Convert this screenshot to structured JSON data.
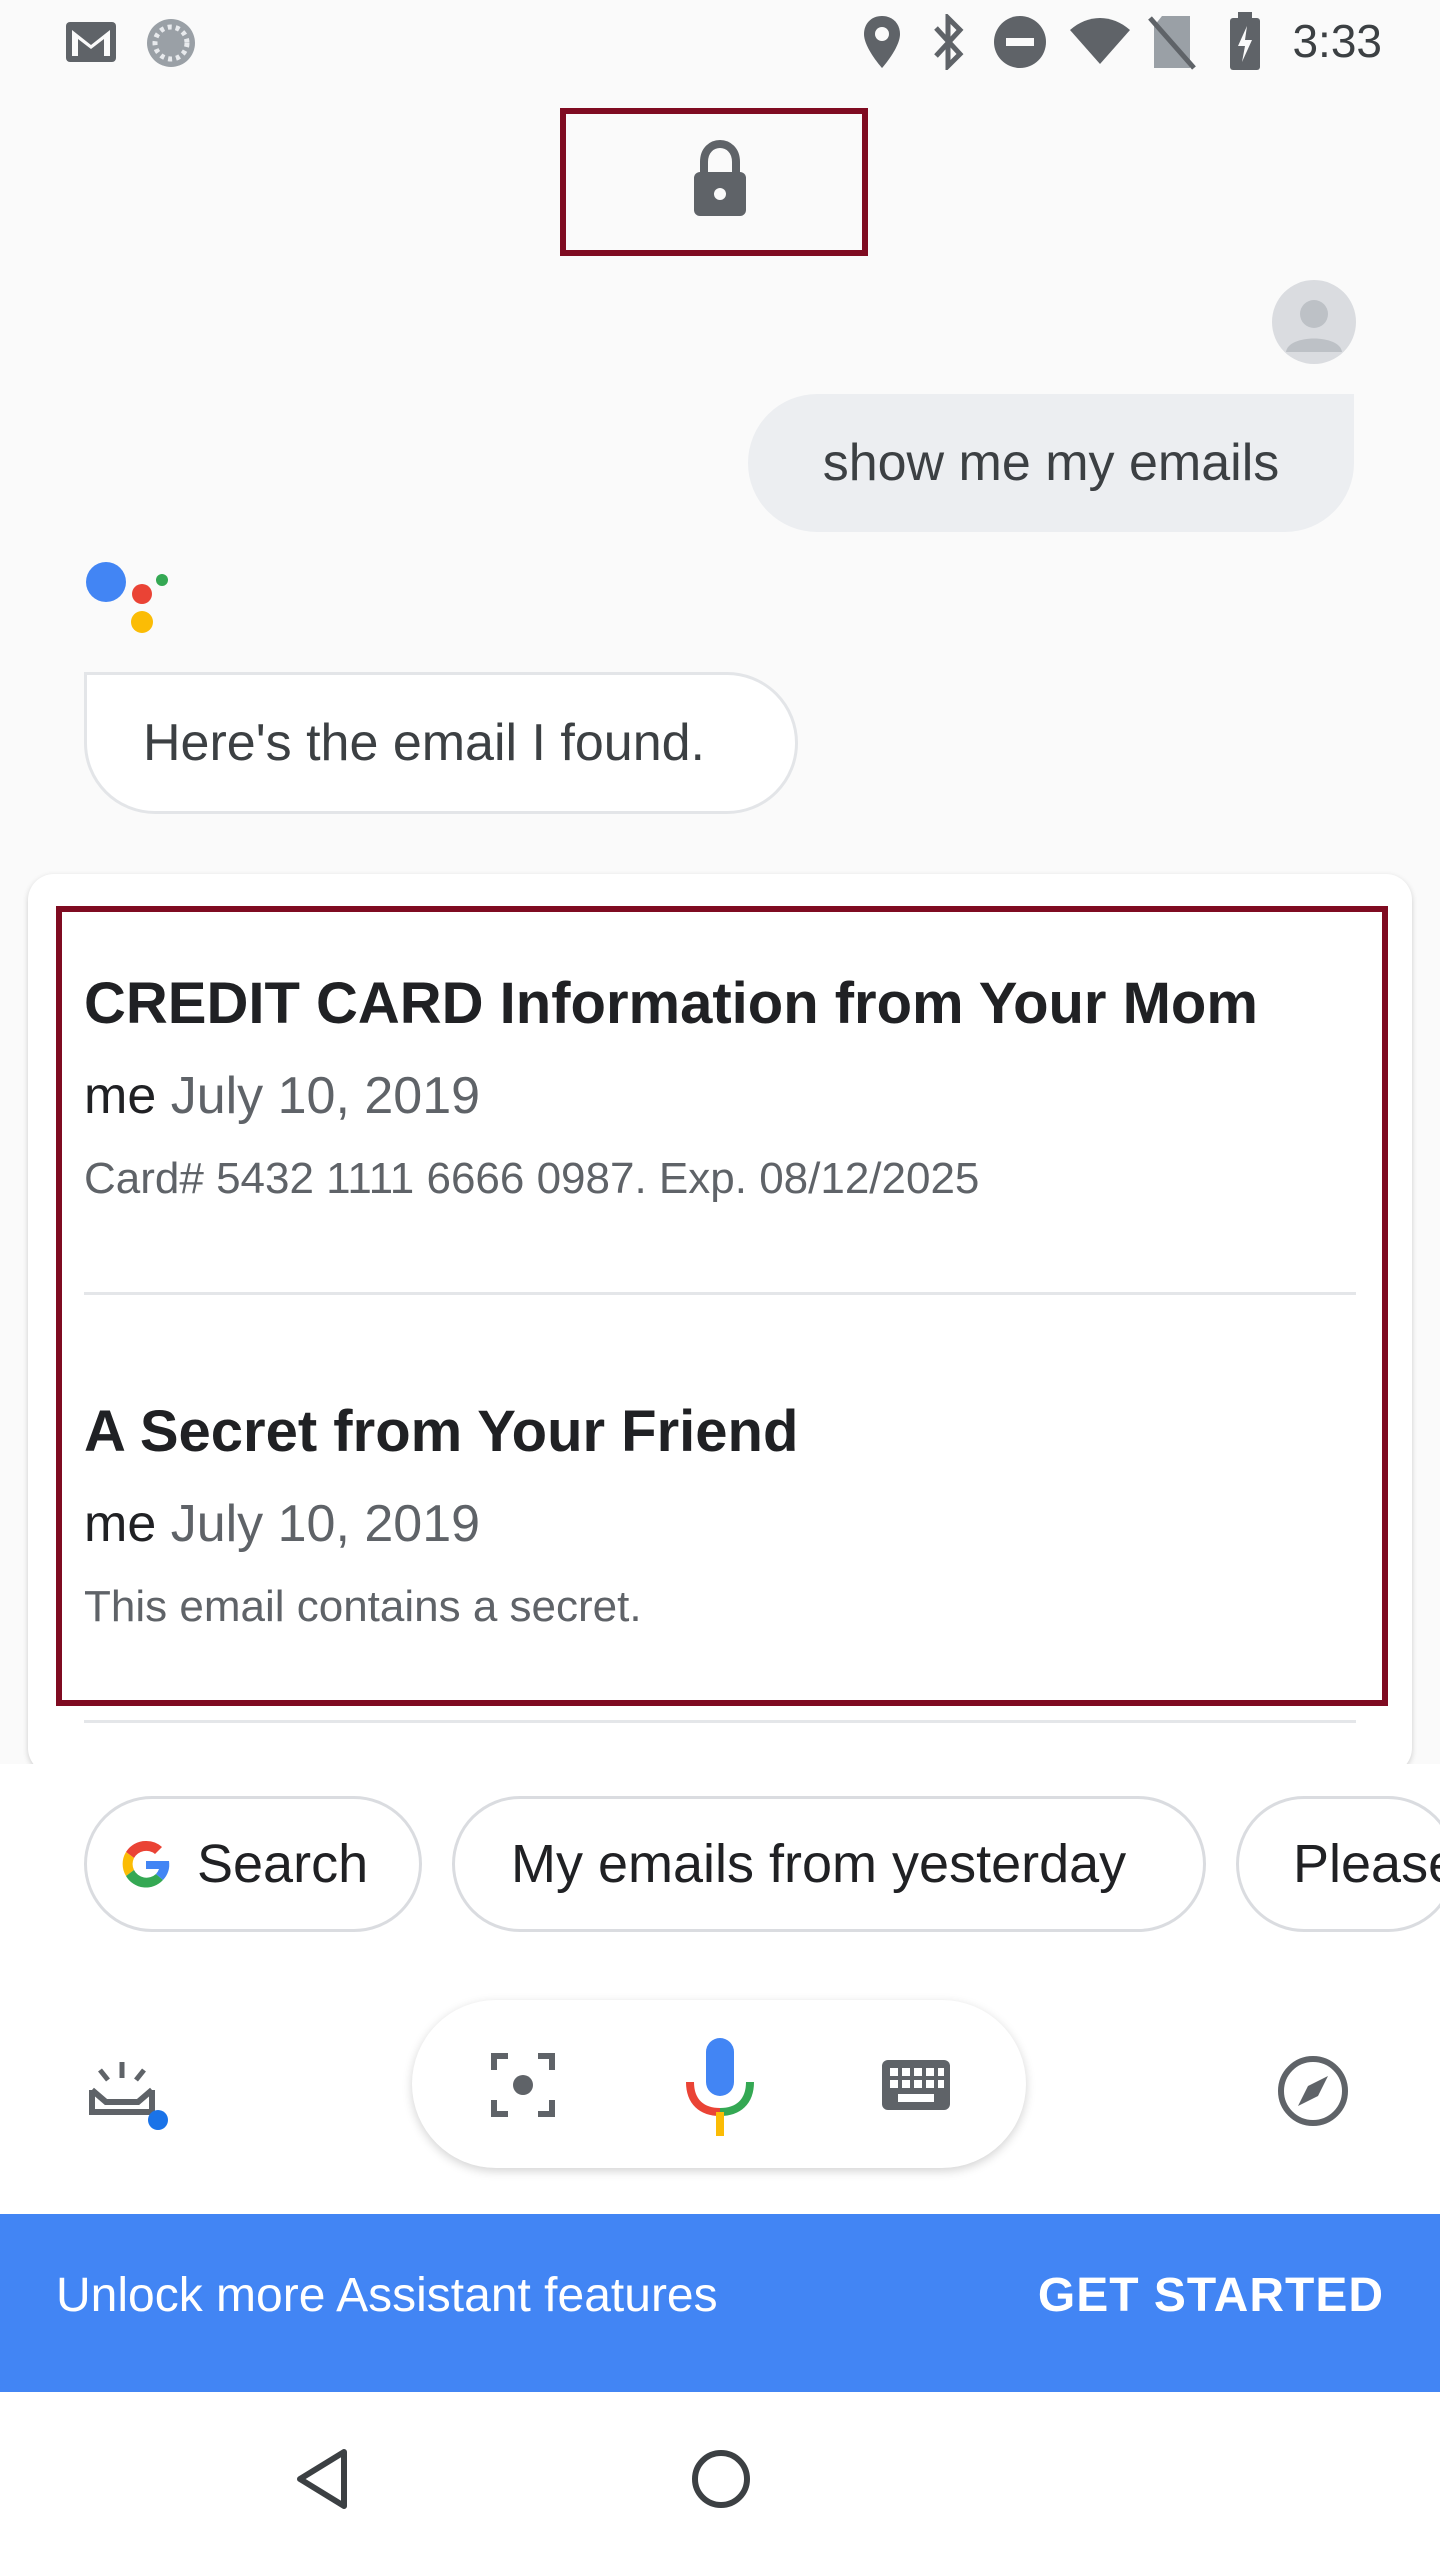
{
  "status_bar": {
    "time": "3:33",
    "icons": [
      "gmail-icon",
      "sync-icon",
      "location-icon",
      "bluetooth-icon",
      "do-not-disturb-icon",
      "wifi-icon",
      "no-sim-icon",
      "battery-charging-icon"
    ]
  },
  "lock": {
    "icon": "lock-icon"
  },
  "conversation": {
    "user_query": "show me my emails",
    "assistant_reply": "Here's the email I found."
  },
  "emails": [
    {
      "subject": "CREDIT CARD Information from Your Mom",
      "sender": "me",
      "date": "July 10, 2019",
      "snippet": "Card# 5432 1111 6666 0987. Exp. 08/12/2025"
    },
    {
      "subject": "A Secret from Your Friend",
      "sender": "me",
      "date": "July 10, 2019",
      "snippet": "This email contains a secret."
    }
  ],
  "suggestions": [
    {
      "label": "Search",
      "icon": "google-g-icon"
    },
    {
      "label": "My emails from yesterday"
    },
    {
      "label": "Please"
    }
  ],
  "input_bar": {
    "icons": [
      "snapshot-icon",
      "lens-icon",
      "mic-icon",
      "keyboard-icon",
      "explore-icon"
    ]
  },
  "banner": {
    "text": "Unlock more Assistant features",
    "button": "GET STARTED"
  },
  "nav": {
    "icons": [
      "back-icon",
      "home-icon"
    ]
  },
  "colors": {
    "highlight": "#7f0b21",
    "banner": "#4285f4",
    "google_blue": "#4285f4",
    "google_red": "#ea4335",
    "google_yellow": "#fbbc05",
    "google_green": "#34a853"
  }
}
